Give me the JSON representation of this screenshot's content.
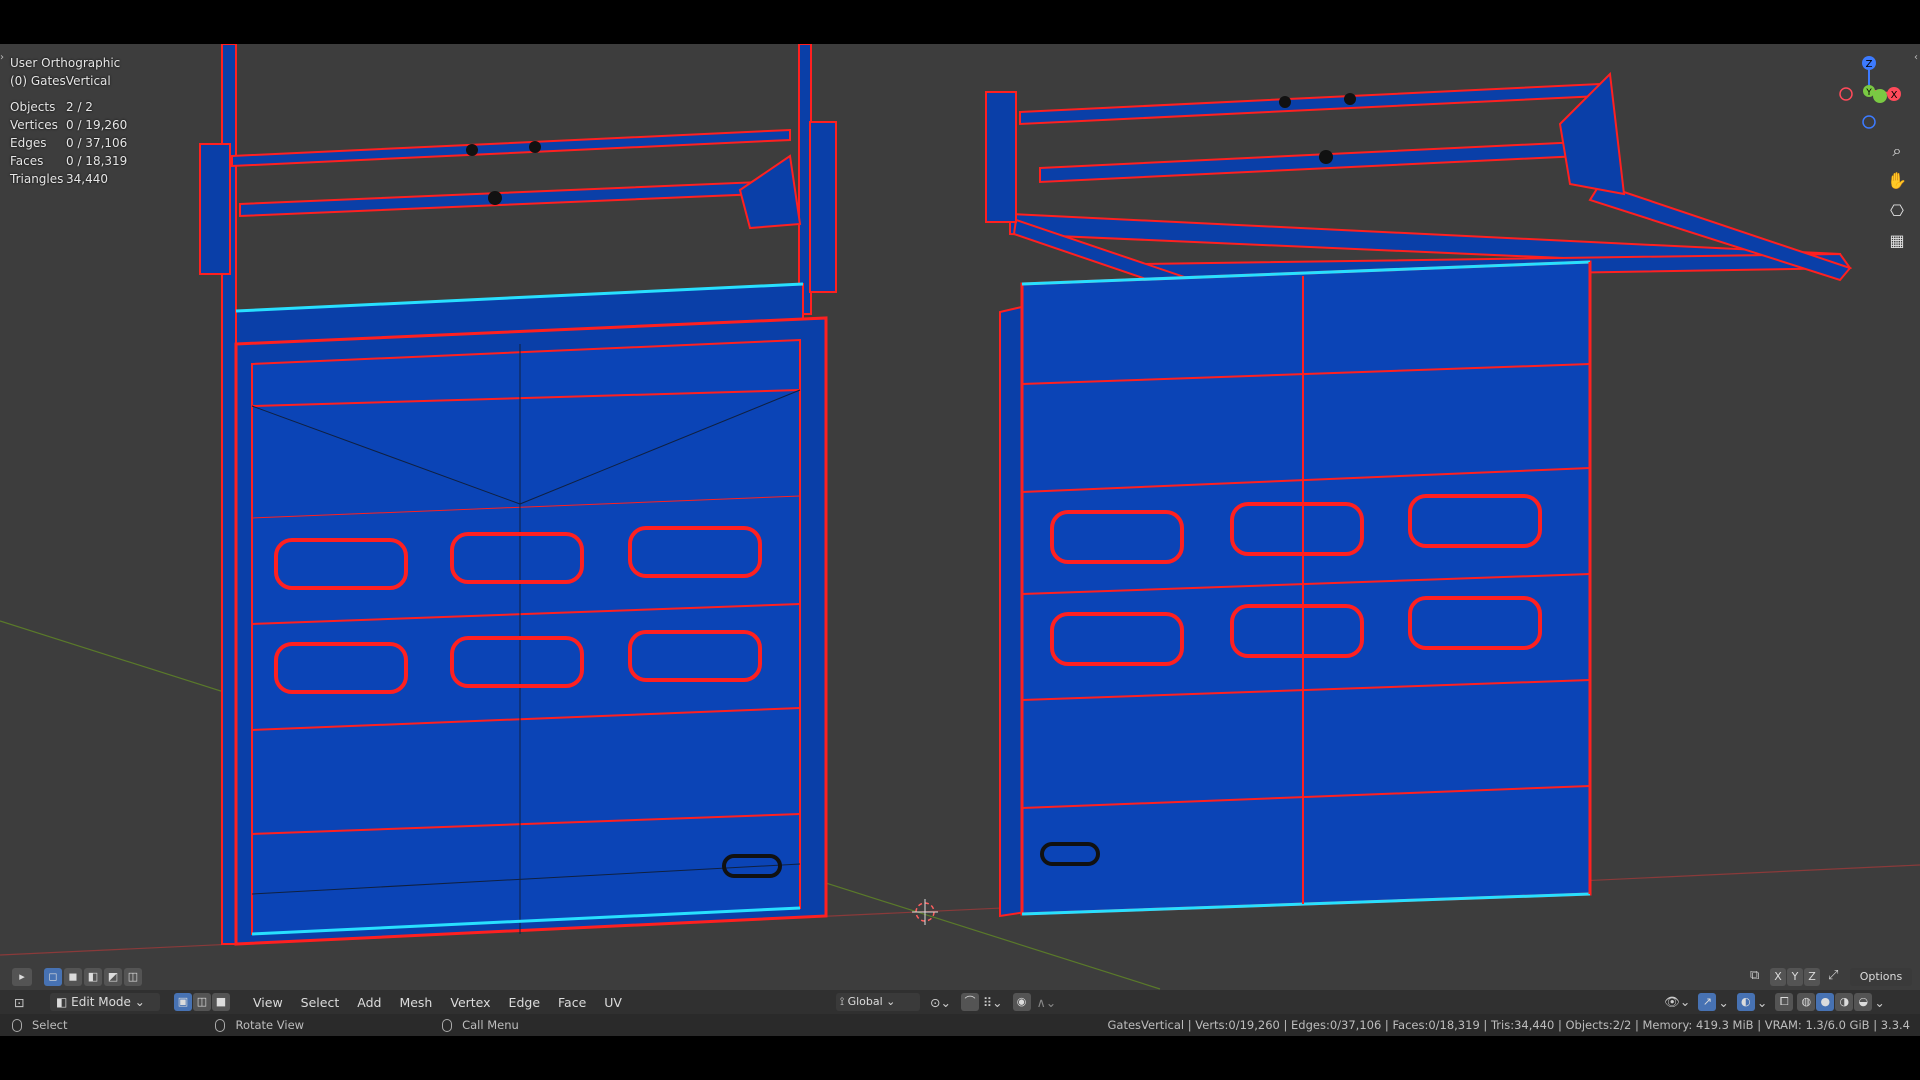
{
  "viewport": {
    "view_name": "User Orthographic",
    "object_name": "(0) GatesVertical",
    "stats": [
      {
        "label": "Objects",
        "value": "2 / 2"
      },
      {
        "label": "Vertices",
        "value": "0 / 19,260"
      },
      {
        "label": "Edges",
        "value": "0 / 37,106"
      },
      {
        "label": "Faces",
        "value": "0 / 18,319"
      },
      {
        "label": "Triangles",
        "value": "34,440"
      }
    ],
    "gizmo": {
      "z": "Z",
      "y": "Y",
      "x": "X"
    }
  },
  "axis_toggles": {
    "x": "X",
    "y": "Y",
    "z": "Z",
    "options": "Options"
  },
  "header": {
    "mode": "Edit Mode",
    "menus": [
      "View",
      "Select",
      "Add",
      "Mesh",
      "Vertex",
      "Edge",
      "Face",
      "UV"
    ],
    "orientation": "Global"
  },
  "statusbar": {
    "hint_select": "Select",
    "hint_rotate": "Rotate View",
    "hint_menu": "Call Menu",
    "info": "GatesVertical | Verts:0/19,260 | Edges:0/37,106 | Faces:0/18,319 | Tris:34,440 | Objects:2/2 | Memory: 419.3 MiB | VRAM: 1.3/6.0 GiB | 3.3.4"
  },
  "colors": {
    "viewport_bg": "#3d3d3d",
    "mesh_face": "#0a3fa8",
    "mesh_edge": "#ff2020",
    "seam_edge": "#28e0ff",
    "accent": "#4772b3"
  }
}
